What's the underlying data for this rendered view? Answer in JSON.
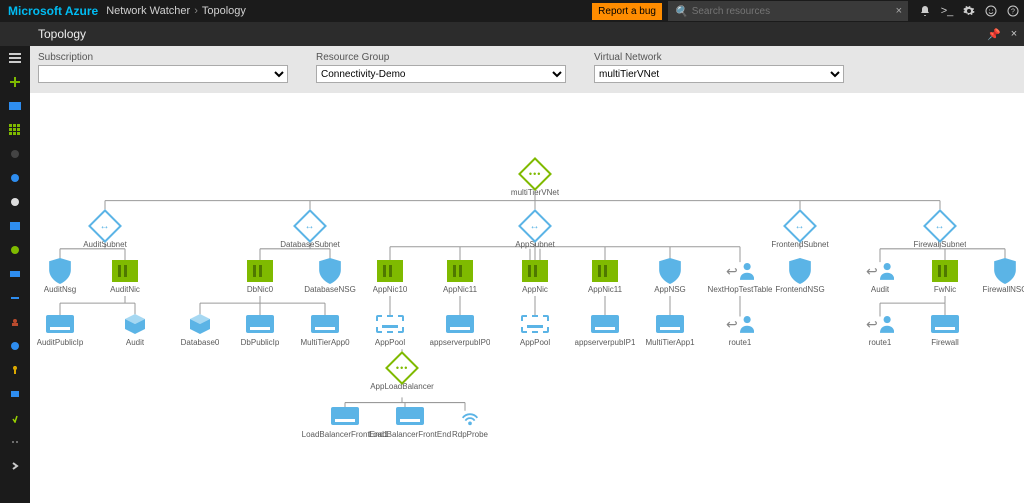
{
  "header": {
    "brand": "Microsoft Azure",
    "crumbs": [
      "Network Watcher",
      "Topology"
    ],
    "report_label": "Report a bug",
    "search_placeholder": "Search resources",
    "icons": [
      "bell-icon",
      "cloudshell-icon",
      "gear-icon",
      "smile-icon",
      "help-icon"
    ]
  },
  "blade": {
    "title": "Topology",
    "pin_icon": "pin-icon",
    "close_icon": "close-icon"
  },
  "filters": {
    "subscription": {
      "label": "Subscription",
      "value": ""
    },
    "resource_group": {
      "label": "Resource Group",
      "value": "Connectivity-Demo"
    },
    "virtual_network": {
      "label": "Virtual Network",
      "value": "multiTierVNet"
    }
  },
  "canvas": {
    "root": {
      "label": "multiTierVNet"
    },
    "subnets": {
      "audit": {
        "label": "AuditSubnet"
      },
      "database": {
        "label": "DatabaseSubnet"
      },
      "app": {
        "label": "AppSubnet"
      },
      "frontend": {
        "label": "FrontendSubnet"
      },
      "firewall": {
        "label": "FirewallSubnet"
      }
    },
    "nodes": {
      "auditnsg": {
        "label": "AuditNsg"
      },
      "auditnic": {
        "label": "AuditNic"
      },
      "auditpubip": {
        "label": "AuditPublicIp"
      },
      "auditvm": {
        "label": "Audit"
      },
      "dbnsg": {
        "label": "DatabaseNSG"
      },
      "dbnic": {
        "label": "DbNic0"
      },
      "database0": {
        "label": "Database0"
      },
      "dbpubip": {
        "label": "DbPublicIp"
      },
      "appnsg": {
        "label": "AppNSG"
      },
      "appnic10": {
        "label": "AppNic10"
      },
      "appnic11": {
        "label": "AppNic11"
      },
      "appnic2": {
        "label": "AppNic"
      },
      "appnic3": {
        "label": "AppNic"
      },
      "appnic4": {
        "label": "AppNic11"
      },
      "multitierapp0": {
        "label": "MultiTierApp0"
      },
      "apppool": {
        "label": "AppPool"
      },
      "appserverpubip0": {
        "label": "appserverpubIP0"
      },
      "apppool2": {
        "label": "AppPool"
      },
      "appserverpubip1": {
        "label": "appserverpubIP1"
      },
      "multitierapp1": {
        "label": "MultiTierApp1"
      },
      "nexthoprt": {
        "label": "NextHopTestTable"
      },
      "route1a": {
        "label": "route1"
      },
      "frontendnsg": {
        "label": "FrontendNSG"
      },
      "auditfwnsg": {
        "label": "Audit"
      },
      "fwnic": {
        "label": "FwNic"
      },
      "route1b": {
        "label": "route1"
      },
      "firewallvm": {
        "label": "Firewall"
      },
      "firewallnsg": {
        "label": "FirewallNSG"
      },
      "applb": {
        "label": "AppLoadBalancer"
      },
      "lbfe1": {
        "label": "LoadBalancerFrontEnd1"
      },
      "lbfe": {
        "label": "LoadBalancerFrontEnd"
      },
      "rdpprobe": {
        "label": "RdpProbe"
      }
    }
  }
}
